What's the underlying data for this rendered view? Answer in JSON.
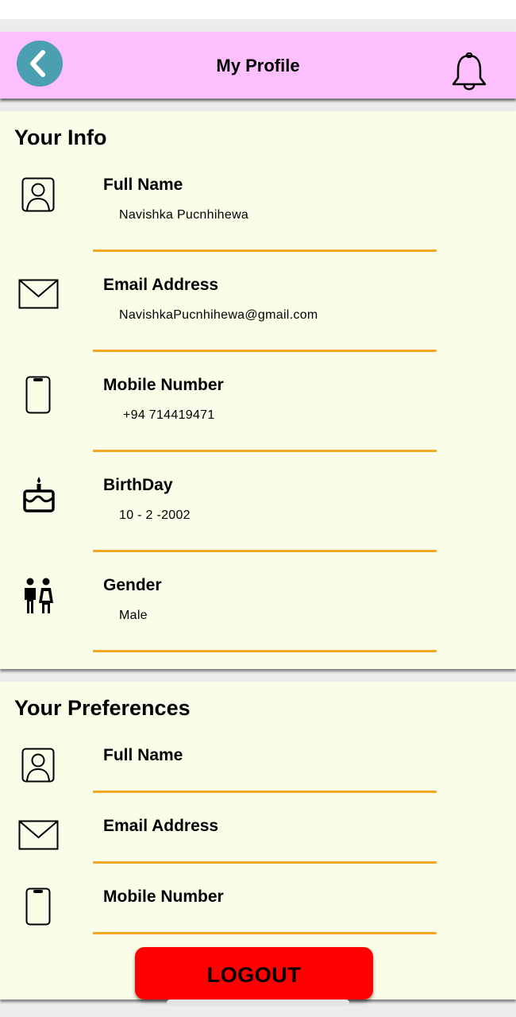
{
  "header": {
    "title": "My Profile",
    "back_icon": "chevron-left-icon",
    "notification_icon": "bell-icon"
  },
  "info": {
    "title": "Your Info",
    "rows": [
      {
        "label": "Full Name",
        "value": "Navishka Pucnhihewa",
        "icon": "user-icon"
      },
      {
        "label": "Email Address",
        "value": "NavishkaPucnhihewa@gmail.com",
        "icon": "mail-icon"
      },
      {
        "label": "Mobile Number",
        "value": "+94 714419471",
        "icon": "phone-icon"
      },
      {
        "label": "BirthDay",
        "value": "10 - 2 -2002",
        "icon": "cake-icon"
      },
      {
        "label": "Gender",
        "value": "Male",
        "icon": "gender-icon"
      }
    ]
  },
  "preferences": {
    "title": "Your Preferences",
    "rows": [
      {
        "label": "Full Name",
        "icon": "user-icon"
      },
      {
        "label": "Email Address",
        "icon": "mail-icon"
      },
      {
        "label": "Mobile Number",
        "icon": "phone-icon"
      }
    ]
  },
  "logout": {
    "label": "LOGOUT"
  },
  "colors": {
    "header_bg": "#fdbffd",
    "back_button": "#4a9fb0",
    "card_bg": "#fbfde9",
    "divider": "#f5a623",
    "logout_bg": "#ff0000"
  }
}
